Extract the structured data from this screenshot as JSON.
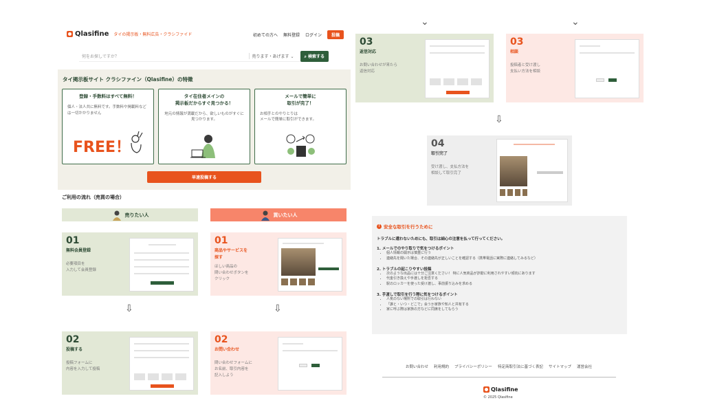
{
  "brand": {
    "logo": "Qlasifine",
    "tagline": "タイの掲示板・無料広告・クラシファイド"
  },
  "nav": {
    "items": [
      "初めての方へ",
      "無料登録",
      "ログイン"
    ],
    "post": "投稿"
  },
  "search": {
    "placeholder": "何をお探しですか？",
    "select": "売ります・あげます",
    "button": "検索する"
  },
  "features": {
    "title": "タイ掲示板サイト クラシファイン（Qlasifine）の特徴",
    "cards": [
      {
        "title": "登録・手数料はすべて無料！",
        "body": "個人・法人共に無料です。手数料や掲載料などは一切かかりません",
        "badge": "FREE！"
      },
      {
        "title": "タイ在住者メインの\n掲示板だからすぐ見つかる！",
        "body": "地元の情報が満載だから、欲しいものがすぐに見つかります。"
      },
      {
        "title": "メールで簡単に\n取引が完了！",
        "body": "お相手とのやりとりは\nメールで簡単に取引ができます。"
      }
    ],
    "cta": "早速投稿する"
  },
  "flow": {
    "title": "ご利用の流れ（売買の場合）",
    "seller": {
      "label": "売りたい人",
      "steps": [
        {
          "num": "01",
          "head": "無料会員登録",
          "body": "必要項目を\n入力して会員登録"
        },
        {
          "num": "02",
          "head": "投稿する",
          "body": "投稿フォームに\n内容を入力して投稿"
        },
        {
          "num": "03",
          "head": "返信対応",
          "body": "お問い合わせが来たら\n返信対応"
        }
      ]
    },
    "buyer": {
      "label": "買いたい人",
      "steps": [
        {
          "num": "01",
          "head": "商品やサービスを\n探す",
          "body": "ほしい商品の\n問い合わせボタンを\nクリック"
        },
        {
          "num": "02",
          "head": "お問い合わせ",
          "body": "問い合わせフォームに\nお名前、取引内容を\n記入しよう"
        },
        {
          "num": "03",
          "head": "相談",
          "body": "投稿者と受け渡し\n支払い方法を相談"
        }
      ]
    },
    "final": {
      "num": "04",
      "head": "取引完了",
      "body": "受け渡し、支払方法を\n相談して取引完了"
    }
  },
  "safety": {
    "title": "安全な取引を行うために",
    "intro": "トラブルに遭わないためにも、取引は細心の注意を払って行ってください。",
    "sections": [
      {
        "head": "1. メールでのやり取りで気をつけるポイント",
        "items": [
          "個人情報の開示は慎重に行う",
          "連絡先を聞いた場合、その連絡先が正しいことを確認する（携帯電話に実際に連絡してみるなど）"
        ]
      },
      {
        "head": "2. トラブルの起こりやすい投稿",
        "items": [
          "次のような出品には十分ご注意ください！ 特に人気商品が詐欺に利用されやすい傾向にあります",
          "代金引き換えや手渡しを拒否する",
          "駅のロッカーを使った受け渡し、事前振り込みを求める"
        ]
      },
      {
        "head": "3. 手渡しで取引を行う際に気をつけるポイント",
        "items": [
          "人気のない場所での取引は行わない",
          "「誰と・いつ・どこで」会うか家族や知人と共有する",
          "家に呼ぶ際は家族の方などに同席をしてもらう"
        ]
      }
    ]
  },
  "footer": {
    "links": [
      "お問い合わせ",
      "利用規約",
      "プライバシーポリシー",
      "特定商取引法に基づく表記",
      "サイトマップ",
      "運営会社"
    ],
    "logo": "Qlasifine",
    "copyright": "© 2025 Qlasifine"
  },
  "colors": {
    "accent": "#e8531d",
    "green": "#2e5e3a"
  }
}
